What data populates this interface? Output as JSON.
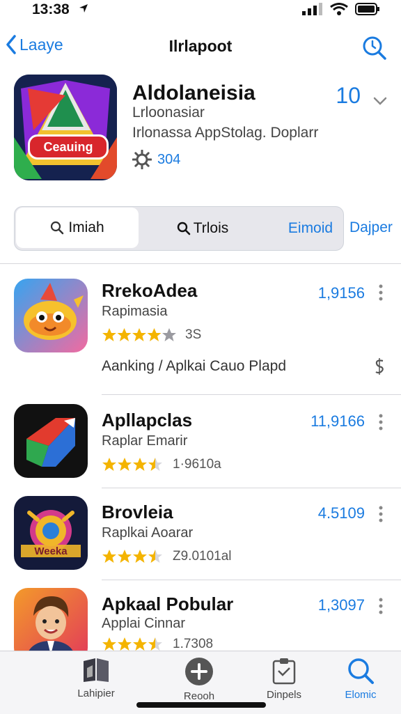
{
  "status": {
    "time": "13:38"
  },
  "nav": {
    "back_label": "Laaye",
    "title": "Ilrlapoot"
  },
  "app": {
    "name": "Aldolaneisia",
    "subtitle": "Lrloonasiar",
    "description": "Irlonassa AppStolag. Doplarr",
    "rating_value": "304",
    "number": "10",
    "icon_text": "Ceauing"
  },
  "segments": [
    {
      "label": "Imiah"
    },
    {
      "label": "Trlois"
    },
    {
      "label": "Eimoid"
    }
  ],
  "segment_extra": "Dajper",
  "list": [
    {
      "name": "RrekoAdea",
      "sub": "Rapimasia",
      "stars": 4,
      "count": "3S",
      "number": "1,9156",
      "rank": "Aanking / Aplkai Cauo Plapd"
    },
    {
      "name": "Apllapclas",
      "sub": "Raplar Emarir",
      "stars": 3.5,
      "count": "1·9610a",
      "number": "11,9166"
    },
    {
      "name": "Brovleia",
      "sub": "Raplkai Aoarar",
      "stars": 3.5,
      "count": "Z9.0101al",
      "number": "4.5109",
      "icon_text": "Weeka"
    },
    {
      "name": "Apkaal Pobular",
      "sub": "Applai Cinnar",
      "stars": 3.5,
      "count": "1.7308",
      "number": "1,3097"
    }
  ],
  "tabs": [
    {
      "label": "Lahipier"
    },
    {
      "label": "Reooh"
    },
    {
      "label": "Dinpels"
    },
    {
      "label": "Elomic"
    }
  ],
  "colors": {
    "accent": "#1a7be0",
    "star": "#f4b400"
  }
}
